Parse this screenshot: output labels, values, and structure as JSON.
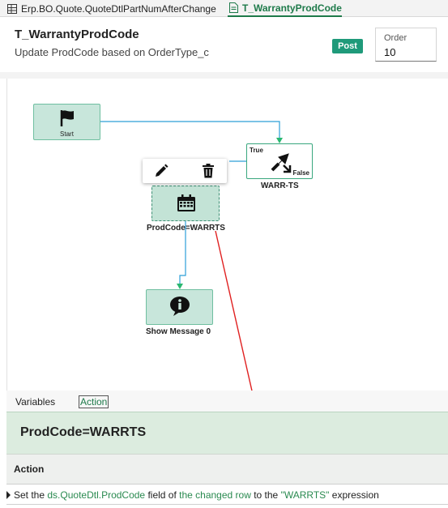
{
  "tabs": [
    {
      "label": "Erp.BO.Quote.QuoteDtlPartNumAfterChange",
      "active": false
    },
    {
      "label": "T_WarrantyProdCode",
      "active": true
    }
  ],
  "header": {
    "title": "T_WarrantyProdCode",
    "subtitle": "Update ProdCode based on OrderType_c",
    "status_badge": "Post",
    "order_label": "Order",
    "order_value": "10"
  },
  "workflow": {
    "nodes": [
      {
        "id": "start",
        "label": "Start",
        "icon": "flag-icon"
      },
      {
        "id": "condition",
        "label": "WARR-TS",
        "icon": "condition-arrows-icon",
        "true_label": "True",
        "false_label": "False"
      },
      {
        "id": "set-field",
        "label": "ProdCode=WARRTS",
        "icon": "calendar-grid-icon",
        "selected": true
      },
      {
        "id": "message",
        "label": "Show Message 0",
        "icon": "info-bubble-icon"
      }
    ],
    "toolbar": {
      "edit_icon": "pencil-icon",
      "delete_icon": "trash-icon"
    }
  },
  "bottom_tabs": [
    {
      "label": "Variables",
      "active": false
    },
    {
      "label": "Action",
      "active": true
    }
  ],
  "action_panel": {
    "title": "ProdCode=WARRTS",
    "column_header": "Action",
    "row": {
      "part1": "Set the ",
      "field": "ds.QuoteDtl.ProdCode",
      "part2": " field of ",
      "target": "the changed row",
      "part3": " to the ",
      "expression": "\"WARRTS\"",
      "part4": " expression"
    }
  },
  "colors": {
    "accent": "#1e7a4a",
    "node_fill": "#c8e6db",
    "node_border": "#6fbfa0",
    "connector": "#2d9fd8",
    "annotation_arrow": "#e02020",
    "badge": "#1f9a7a"
  }
}
